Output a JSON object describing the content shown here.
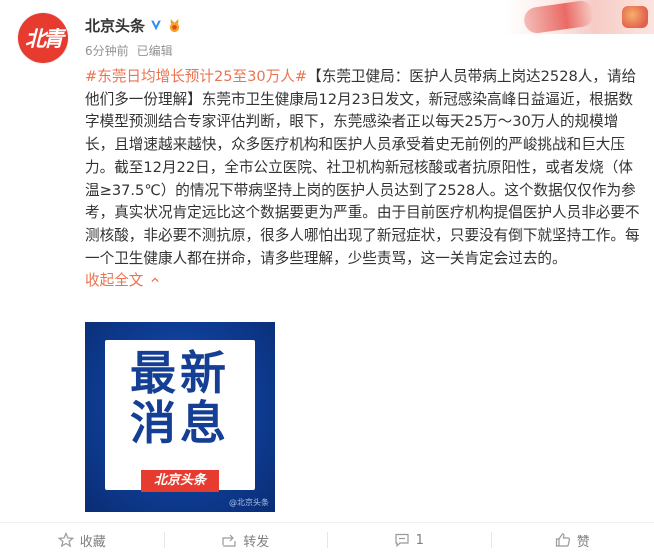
{
  "author": {
    "name": "北京头条",
    "avatar_text": "北青",
    "verified_icon": "blue-v-badge-icon",
    "gold_icon": "gold-fan-badge-icon"
  },
  "meta": {
    "time": "6分钟前",
    "edited": "已编辑"
  },
  "post": {
    "tag": "#东莞日均增长预计25至30万人#",
    "body": "【东莞卫健局：医护人员带病上岗达2528人，请给他们多一份理解】东莞市卫生健康局12月23日发文，新冠感染高峰日益逼近，根据数字模型预测结合专家评估判断，眼下，东莞感染者正以每天25万～30万人的规模增长，且增速越来越快，众多医疗机构和医护人员承受着史无前例的严峻挑战和巨大压力。截至12月22日，全市公立医院、社卫机构新冠核酸或者抗原阳性，或者发烧（体温≥37.5℃）的情况下带病坚持上岗的医护人员达到了2528人。这个数据仅仅作为参考，真实状况肯定远比这个数据要更为严重。由于目前医疗机构提倡医护人员非必要不测核酸，非必要不测抗原，很多人哪怕出现了新冠症状，只要没有倒下就坚持工作。每一个卫生健康人都在拼命，请多些理解，少些责骂，这一关肯定会过去的。",
    "collapse_label": "收起全文"
  },
  "image": {
    "title": "最新消息",
    "brand": "北京头条",
    "watermark": "@北京头条"
  },
  "actions": {
    "favorite": "收藏",
    "repost": "转发",
    "comment_count": "1",
    "like": "赞"
  },
  "colors": {
    "link": "#eb7350",
    "text": "#333333",
    "meta": "#939393",
    "image_bg": "#0e3c93",
    "brand_red": "#e63b2e"
  }
}
